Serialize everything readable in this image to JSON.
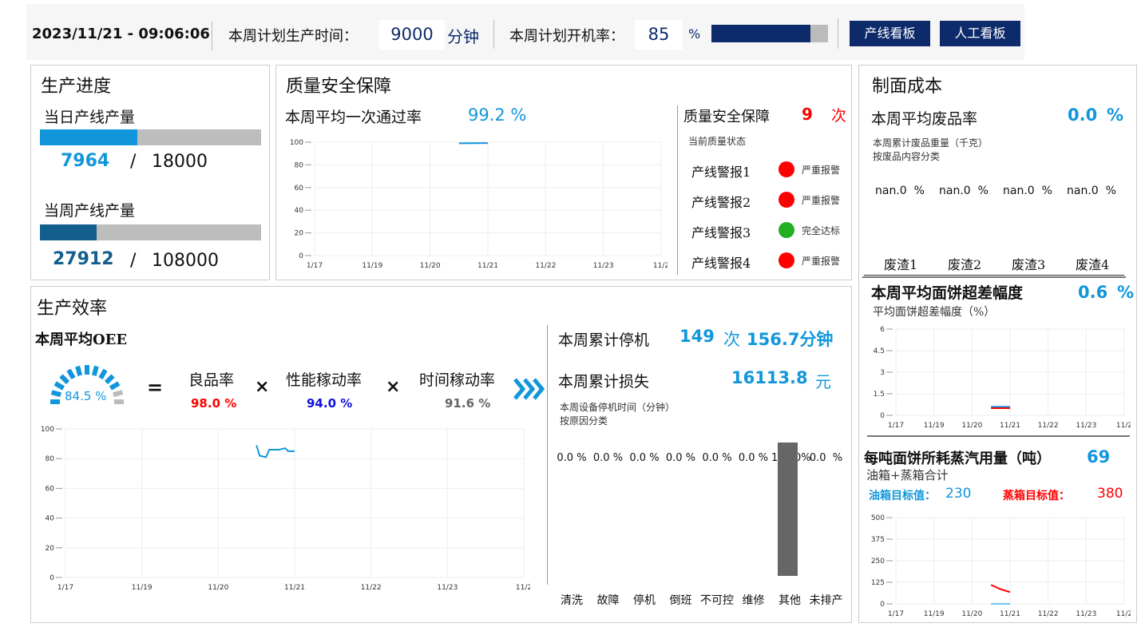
{
  "header": {
    "datetime": "2023/11/21 - 09:06:06",
    "plan_time_label": "本周计划生产时间：",
    "plan_time_value": "9000",
    "plan_time_unit": "分钟",
    "plan_rate_label": "本周计划开机率：",
    "plan_rate_value": "85",
    "plan_rate_unit": "%",
    "plan_rate_progress": 85,
    "btn_line": "产线看板",
    "btn_manual": "人工看板"
  },
  "progress": {
    "title": "生产进度",
    "daily_label": "当日产线产量",
    "daily_value": "7964",
    "daily_target": "18000",
    "daily_fraction": 0.442,
    "weekly_label": "当周产线产量",
    "weekly_value": "27912",
    "weekly_target": "108000",
    "weekly_fraction": 0.258,
    "slash": "/"
  },
  "quality": {
    "title": "质量安全保障",
    "pass_label": "本周平均一次通过率",
    "pass_value": "99.2 %",
    "side_title": "质量安全保障",
    "count": "9",
    "count_unit": "次",
    "status_label": "当前质量状态",
    "alarms": [
      {
        "name": "产线警报1",
        "status": "严重报警",
        "color": "#f00"
      },
      {
        "name": "产线警报2",
        "status": "严重报警",
        "color": "#f00"
      },
      {
        "name": "产线警报3",
        "status": "完全达标",
        "color": "#22b022"
      },
      {
        "name": "产线警报4",
        "status": "严重报警",
        "color": "#f00"
      }
    ]
  },
  "efficiency": {
    "title": "生产效率",
    "oee_label": "本周平均OEE",
    "oee_value": "84.5 %",
    "oee_fraction": 0.845,
    "eq": "=",
    "times": "×",
    "good_label": "良品率",
    "good_value": "98.0 %",
    "perf_label": "性能稼动率",
    "perf_value": "94.0 %",
    "time_label": "时间稼动率",
    "time_value": "91.6 %",
    "stop_label": "本周累计停机",
    "stop_count": "149",
    "stop_count_unit": "次",
    "stop_minutes": "156.7分钟",
    "loss_label": "本周累计损失",
    "loss_value": "16113.8",
    "loss_unit": "元",
    "stop_chart_title": "本周设备停机时间（分钟）",
    "stop_chart_sub": "按原因分类"
  },
  "cost": {
    "title": "制面成本",
    "waste_label": "本周平均废品率",
    "waste_value": "0.0",
    "waste_unit": "%",
    "waste_weight": "本周累计废品重量（千克）",
    "waste_by": "按废品内容分类",
    "waste_items": [
      {
        "name": "废渣1",
        "value": "nan.0  %"
      },
      {
        "name": "废渣2",
        "value": "nan.0  %"
      },
      {
        "name": "废渣3",
        "value": "nan.0  %"
      },
      {
        "name": "废渣4",
        "value": "nan.0  %"
      }
    ],
    "overrun_label": "本周平均面饼超差幅度",
    "overrun_value": "0.6",
    "overrun_unit": "%",
    "overrun_sub": "平均面饼超差幅度（%）",
    "steam_label": "每吨面饼所耗蒸汽用量（吨）",
    "steam_value": "69",
    "steam_sub": "油箱+蒸箱合计",
    "oil_target_label": "油箱目标值：",
    "oil_target": "230",
    "steam_target_label": "蒸箱目标值：",
    "steam_target": "380"
  },
  "chart_data": [
    {
      "id": "quality",
      "type": "line",
      "ylim": [
        0,
        100
      ],
      "yticks": [
        "0",
        "20",
        "40",
        "60",
        "80",
        "100"
      ],
      "xticks": [
        "1/17",
        "11/19",
        "11/20",
        "11/21",
        "11/22",
        "11/23",
        "11/2"
      ],
      "grid": true,
      "series": [
        {
          "color": "#1296db",
          "points": [
            [
              "11/20 12:00",
              99
            ],
            [
              "11/21 00:00",
              99.2
            ]
          ]
        }
      ]
    },
    {
      "id": "oee",
      "type": "line",
      "ylim": [
        0,
        100
      ],
      "yticks": [
        "0",
        "20",
        "40",
        "60",
        "80",
        "100"
      ],
      "xticks": [
        "1/17",
        "11/19",
        "11/20",
        "11/21",
        "11/22",
        "11/23",
        "11/2"
      ],
      "grid": true,
      "series": [
        {
          "color": "#1296db",
          "points": [
            [
              "11/20 12:00",
              89
            ],
            [
              "11/20 13:00",
              82
            ],
            [
              "11/20 15:00",
              81
            ],
            [
              "11/20 16:00",
              86
            ],
            [
              "11/20 19:00",
              86
            ],
            [
              "11/20 21:00",
              87
            ],
            [
              "11/20 22:00",
              85
            ],
            [
              "11/21 00:00",
              85
            ]
          ]
        }
      ]
    },
    {
      "id": "stops",
      "type": "bar",
      "categories": [
        "清洗",
        "故障",
        "停机",
        "倒班",
        "不可控",
        "维修",
        "其他",
        "未排产"
      ],
      "labels": [
        "0.0 %",
        "0.0 %",
        "0.0 %",
        "0.0 %",
        "0.0 %",
        "0.0 %",
        "100.0%",
        "0.0  %"
      ],
      "values": [
        0,
        0,
        0,
        0,
        0,
        0,
        100,
        0
      ],
      "color": "#666666"
    },
    {
      "id": "overrun",
      "type": "line",
      "ylim": [
        0,
        6
      ],
      "yticks": [
        "0",
        "1.5",
        "3",
        "4.5",
        "6"
      ],
      "xticks": [
        "1/17",
        "11/19",
        "11/20",
        "11/21",
        "11/22",
        "11/23",
        "11/2"
      ],
      "grid": true,
      "series": [
        {
          "color": "#1296db",
          "points": [
            [
              "11/20 12:00",
              0.6
            ],
            [
              "11/21 00:00",
              0.6
            ]
          ]
        },
        {
          "color": "#f00",
          "points": [
            [
              "11/20 12:00",
              0.5
            ],
            [
              "11/21 00:00",
              0.5
            ]
          ]
        }
      ]
    },
    {
      "id": "steam",
      "type": "line",
      "ylim": [
        0,
        500
      ],
      "yticks": [
        "0",
        "125",
        "250",
        "375",
        "500"
      ],
      "xticks": [
        "1/17",
        "11/19",
        "11/20",
        "11/21",
        "11/22",
        "11/23",
        "11/2"
      ],
      "grid": true,
      "series": [
        {
          "color": "#f00",
          "points": [
            [
              "11/20 12:00",
              110
            ],
            [
              "11/20 18:00",
              85
            ],
            [
              "11/21 00:00",
              68
            ]
          ]
        },
        {
          "color": "#6fc3ee",
          "points": [
            [
              "11/20 12:00",
              0
            ],
            [
              "11/21 00:00",
              0
            ]
          ]
        }
      ]
    }
  ]
}
